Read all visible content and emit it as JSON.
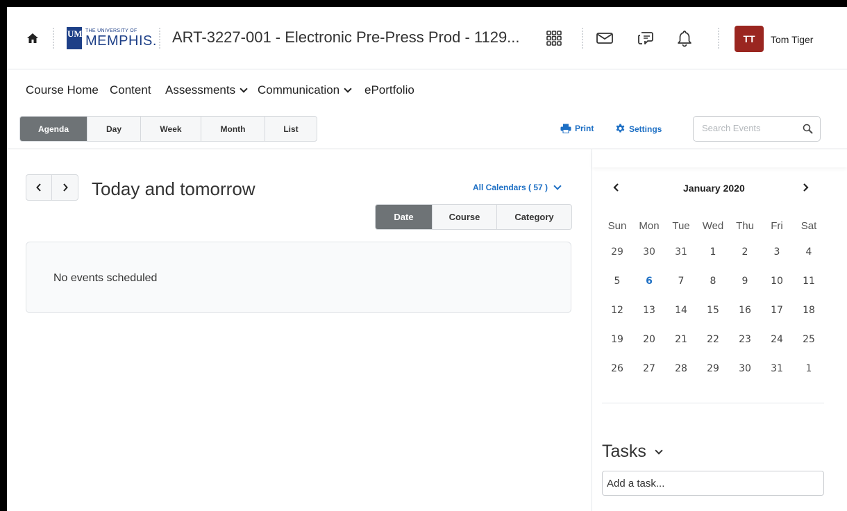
{
  "header": {
    "logo_letters": "UM",
    "logo_small": "THE UNIVERSITY OF",
    "logo_big": "MEMPHIS.",
    "course_title": "ART-3227-001 - Electronic Pre-Press Prod - 1129...",
    "user_initials": "TT",
    "user_name": "Tom Tiger",
    "avatar_color": "#9a2620"
  },
  "nav": {
    "items": [
      {
        "label": "Course Home"
      },
      {
        "label": "Content"
      },
      {
        "label": "Assessments"
      },
      {
        "label": "Communication"
      },
      {
        "label": "ePortfolio"
      }
    ]
  },
  "toolbar": {
    "views": [
      {
        "label": "Agenda",
        "active": true
      },
      {
        "label": "Day"
      },
      {
        "label": "Week"
      },
      {
        "label": "Month"
      },
      {
        "label": "List"
      }
    ],
    "print_label": "Print",
    "settings_label": "Settings",
    "search_placeholder": "Search Events",
    "accent": "#1d6fc4"
  },
  "agenda": {
    "title": "Today and tomorrow",
    "all_calendars": "All Calendars ( 57 )",
    "group_tabs": [
      {
        "label": "Date",
        "active": true
      },
      {
        "label": "Course"
      },
      {
        "label": "Category"
      }
    ],
    "empty_message": "No events scheduled"
  },
  "mini_calendar": {
    "month": "January 2020",
    "weekdays": [
      "Sun",
      "Mon",
      "Tue",
      "Wed",
      "Thu",
      "Fri",
      "Sat"
    ],
    "weeks": [
      [
        "29",
        "30",
        "31",
        "1",
        "2",
        "3",
        "4"
      ],
      [
        "5",
        "6",
        "7",
        "8",
        "9",
        "10",
        "11"
      ],
      [
        "12",
        "13",
        "14",
        "15",
        "16",
        "17",
        "18"
      ],
      [
        "19",
        "20",
        "21",
        "22",
        "23",
        "24",
        "25"
      ],
      [
        "26",
        "27",
        "28",
        "29",
        "30",
        "31",
        "1"
      ]
    ],
    "today": "6"
  },
  "tasks": {
    "title": "Tasks",
    "input_placeholder": "Add a task..."
  }
}
